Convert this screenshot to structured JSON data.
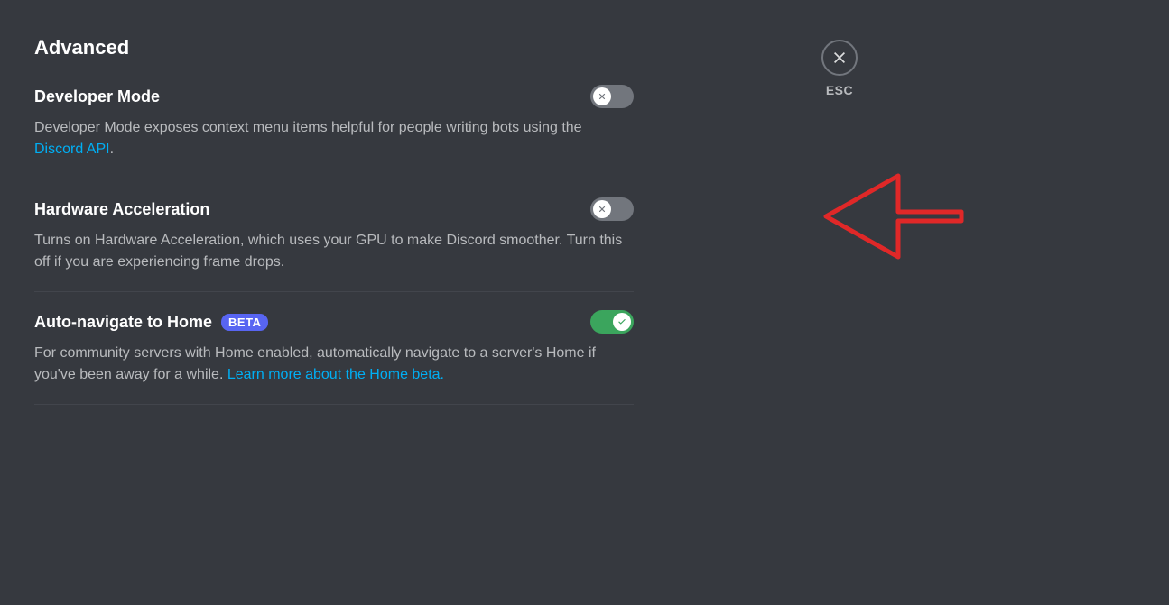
{
  "page": {
    "title": "Advanced"
  },
  "close": {
    "label": "ESC"
  },
  "settings": {
    "developerMode": {
      "label": "Developer Mode",
      "description_pre": "Developer Mode exposes context menu items helpful for people writing bots using the ",
      "link_text": "Discord API",
      "description_post": ".",
      "enabled": false
    },
    "hardwareAcceleration": {
      "label": "Hardware Acceleration",
      "description": "Turns on Hardware Acceleration, which uses your GPU to make Discord smoother. Turn this off if you are experiencing frame drops.",
      "enabled": false
    },
    "autoNavigateHome": {
      "label": "Auto-navigate to Home",
      "badge": "BETA",
      "description_pre": "For community servers with Home enabled, automatically navigate to a server's Home if you've been away for a while. ",
      "link_text": "Learn more about the Home beta.",
      "enabled": true
    }
  },
  "annotation": {
    "arrow_color": "#e02828"
  }
}
